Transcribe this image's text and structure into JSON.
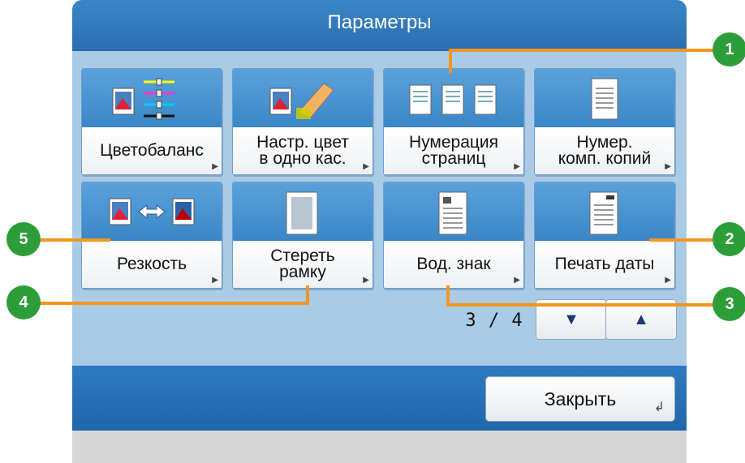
{
  "dialog": {
    "title": "Параметры"
  },
  "tiles": [
    {
      "label": "Цветобаланс",
      "icon": "color-balance-icon"
    },
    {
      "label": "Настр. цвет\nв одно кас.",
      "icon": "one-touch-color-icon"
    },
    {
      "label": "Нумерация\nстраниц",
      "icon": "page-numbering-icon"
    },
    {
      "label": "Нумер.\nкомп. копий",
      "icon": "copy-set-numbering-icon"
    },
    {
      "label": "Резкость",
      "icon": "sharpness-icon"
    },
    {
      "label": "Стереть\nрамку",
      "icon": "erase-frame-icon"
    },
    {
      "label": "Вод. знак",
      "icon": "watermark-icon"
    },
    {
      "label": "Печать даты",
      "icon": "print-date-icon"
    }
  ],
  "pager": {
    "text": "3 / 4"
  },
  "nav": {
    "down": "▼",
    "up": "▲"
  },
  "footer": {
    "close_label": "Закрыть"
  },
  "callouts": [
    "1",
    "2",
    "3",
    "4",
    "5"
  ],
  "colors": {
    "accent": "#f2961e",
    "badge": "#2d9d3a",
    "titlebar": "#2a6db0"
  }
}
